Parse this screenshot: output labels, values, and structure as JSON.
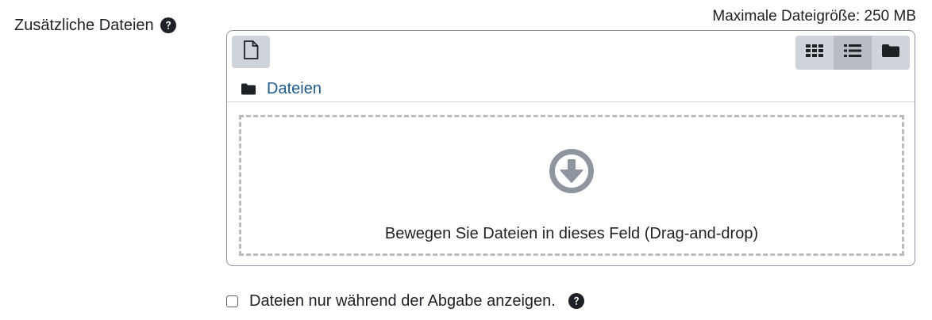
{
  "field": {
    "label": "Zusätzliche Dateien",
    "help_icon": "question-circle-icon"
  },
  "filemanager": {
    "max_size_text": "Maximale Dateigröße: 250 MB",
    "add_file_icon": "file-icon",
    "view_modes": [
      {
        "icon": "grid-icon",
        "active": false
      },
      {
        "icon": "list-icon",
        "active": true
      },
      {
        "icon": "folder-icon",
        "active": false
      }
    ],
    "path": {
      "icon": "folder-icon",
      "label": "Dateien"
    },
    "dropzone": {
      "icon": "arrow-circle-down-icon",
      "text": "Bewegen Sie Dateien in dieses Feld (Drag-and-drop)"
    }
  },
  "option": {
    "checked": false,
    "label": "Dateien nur während der Abgabe anzeigen.",
    "help_icon": "question-circle-icon"
  },
  "colors": {
    "text": "#1d2125",
    "link": "#1f5a8c",
    "button_bg": "#ced4da",
    "button_active_bg": "#b7bdc3",
    "icon_gray": "#8f959e"
  }
}
